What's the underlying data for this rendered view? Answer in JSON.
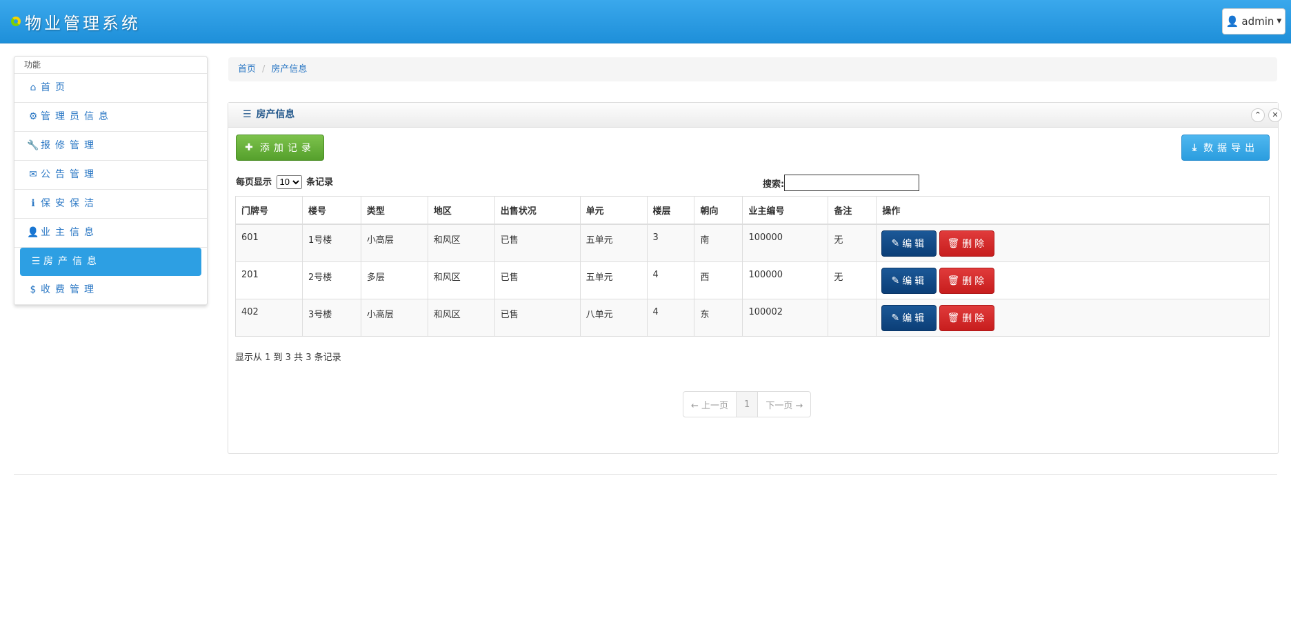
{
  "brand": {
    "title": "物业管理系统"
  },
  "user": {
    "name": "admin"
  },
  "sidebar": {
    "header": "功能",
    "items": [
      {
        "label": "首页",
        "icon": "home-icon",
        "glyph": "⌂"
      },
      {
        "label": "管理员信息",
        "icon": "gear-icon",
        "glyph": "⚙"
      },
      {
        "label": "报修管理",
        "icon": "wrench-icon",
        "glyph": "🔧"
      },
      {
        "label": "公告管理",
        "icon": "envelope-icon",
        "glyph": "✉"
      },
      {
        "label": "保安保洁",
        "icon": "info-icon",
        "glyph": "ℹ"
      },
      {
        "label": "业主信息",
        "icon": "user-icon",
        "glyph": "👤"
      },
      {
        "label": "房产信息",
        "icon": "list-icon",
        "glyph": "☰",
        "active": true
      },
      {
        "label": "收费管理",
        "icon": "dollar-icon",
        "glyph": "$"
      }
    ]
  },
  "breadcrumb": {
    "home": "首页",
    "current": "房产信息"
  },
  "panel": {
    "title": "房产信息",
    "add_label": "添加记录",
    "export_label": "数据导出",
    "length_prefix": "每页显示",
    "length_value": "10",
    "length_suffix": "条记录",
    "search_label": "搜索:",
    "search_value": ""
  },
  "table": {
    "columns": [
      "门牌号",
      "楼号",
      "类型",
      "地区",
      "出售状况",
      "单元",
      "楼层",
      "朝向",
      "业主编号",
      "备注",
      "操作"
    ],
    "rows": [
      [
        "601",
        "1号楼",
        "小高层",
        "和风区",
        "已售",
        "五单元",
        "3",
        "南",
        "100000",
        "无"
      ],
      [
        "201",
        "2号楼",
        "多层",
        "和风区",
        "已售",
        "五单元",
        "4",
        "西",
        "100000",
        "无"
      ],
      [
        "402",
        "3号楼",
        "小高层",
        "和风区",
        "已售",
        "八单元",
        "4",
        "东",
        "100002",
        ""
      ]
    ],
    "edit_label": "编辑",
    "delete_label": "删除"
  },
  "info": "显示从 1 到 3 共 3 条记录",
  "pagination": {
    "prev": "← 上一页",
    "current": "1",
    "next": "下一页 →"
  },
  "colors": {
    "navbar": "#2a9ae4",
    "active": "#2d9fe3",
    "add": "#62ad36",
    "export": "#35a6e6",
    "edit": "#124b88",
    "delete": "#d42a2a"
  }
}
